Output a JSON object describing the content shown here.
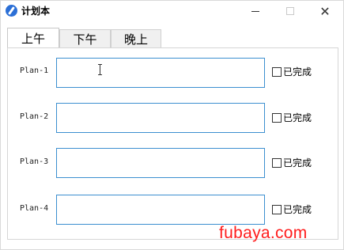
{
  "window": {
    "title": "计划本",
    "close_glyph": "✕",
    "app_icon": "pen-icon"
  },
  "tabs": [
    {
      "label": "上午",
      "active": true
    },
    {
      "label": "下午",
      "active": false
    },
    {
      "label": "晚上",
      "active": false
    }
  ],
  "plans": [
    {
      "label": "Plan-1",
      "value": "",
      "done_label": "已完成",
      "done": false
    },
    {
      "label": "Plan-2",
      "value": "",
      "done_label": "已完成",
      "done": false
    },
    {
      "label": "Plan-3",
      "value": "",
      "done_label": "已完成",
      "done": false
    },
    {
      "label": "Plan-4",
      "value": "",
      "done_label": "已完成",
      "done": false
    }
  ],
  "watermark": "fubaya.com",
  "colors": {
    "input_border": "#3c8fd0",
    "watermark": "#ff1d1d",
    "app_icon": "#2b6fd6"
  }
}
